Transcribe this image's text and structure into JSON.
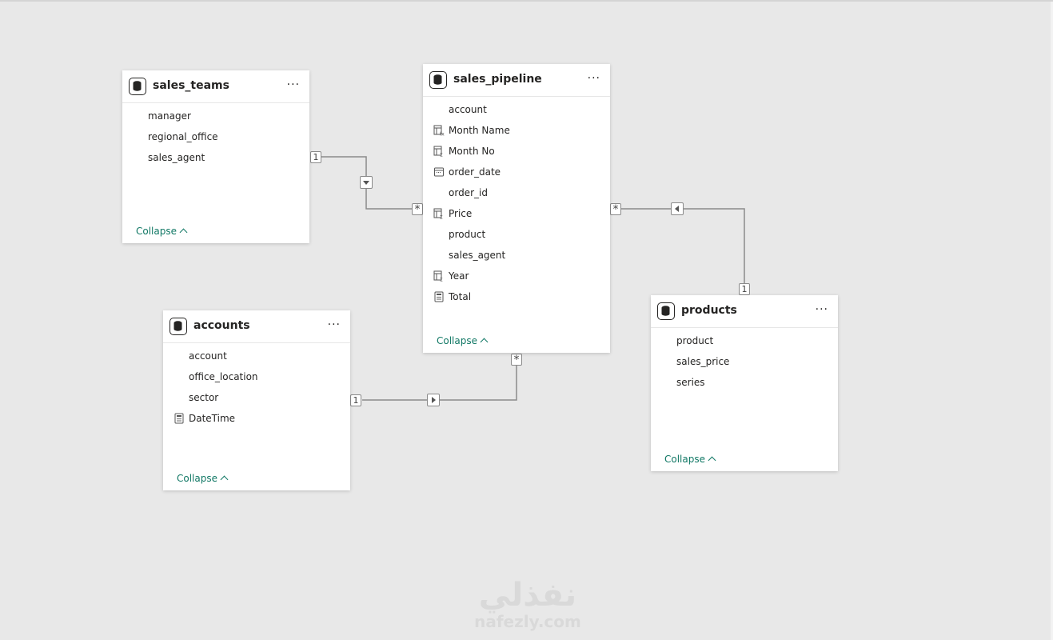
{
  "tables": [
    {
      "title": "sales_teams",
      "more": "···",
      "fields": [
        {
          "name": "manager",
          "icon": "none"
        },
        {
          "name": "regional_office",
          "icon": "none"
        },
        {
          "name": "sales_agent",
          "icon": "none"
        }
      ],
      "collapse": "Collapse"
    },
    {
      "title": "sales_pipeline",
      "more": "···",
      "fields": [
        {
          "name": "account",
          "icon": "none"
        },
        {
          "name": "Month Name",
          "icon": "calculated-column-icon"
        },
        {
          "name": "Month No",
          "icon": "calculated-column-icon"
        },
        {
          "name": "order_date",
          "icon": "date-column-icon"
        },
        {
          "name": "order_id",
          "icon": "none"
        },
        {
          "name": "Price",
          "icon": "calculated-column-icon"
        },
        {
          "name": "product",
          "icon": "none"
        },
        {
          "name": "sales_agent",
          "icon": "none"
        },
        {
          "name": "Year",
          "icon": "calculated-column-icon"
        },
        {
          "name": "Total",
          "icon": "measure-calculator-icon"
        }
      ],
      "collapse": "Collapse"
    },
    {
      "title": "accounts",
      "more": "···",
      "fields": [
        {
          "name": "account",
          "icon": "none"
        },
        {
          "name": "office_location",
          "icon": "none"
        },
        {
          "name": "sector",
          "icon": "none"
        },
        {
          "name": "DateTime",
          "icon": "measure-calculator-icon"
        }
      ],
      "collapse": "Collapse"
    },
    {
      "title": "products",
      "more": "···",
      "fields": [
        {
          "name": "product",
          "icon": "none"
        },
        {
          "name": "sales_price",
          "icon": "none"
        },
        {
          "name": "series",
          "icon": "none"
        }
      ],
      "collapse": "Collapse"
    }
  ],
  "relationships": [
    {
      "from": "sales_teams",
      "to": "sales_pipeline",
      "from_cardinality": "1",
      "to_cardinality": "*",
      "filter_direction": "down"
    },
    {
      "from": "products",
      "to": "sales_pipeline",
      "from_cardinality": "1",
      "to_cardinality": "*",
      "filter_direction": "left"
    },
    {
      "from": "accounts",
      "to": "sales_pipeline",
      "from_cardinality": "1",
      "to_cardinality": "*",
      "filter_direction": "right"
    }
  ],
  "watermark": {
    "main": "نفذلي",
    "sub": "nafezly.com"
  },
  "colors": {
    "canvas": "#e8e8e8",
    "card": "#ffffff",
    "collapse_link": "#117865",
    "line": "#8a8a8a"
  }
}
